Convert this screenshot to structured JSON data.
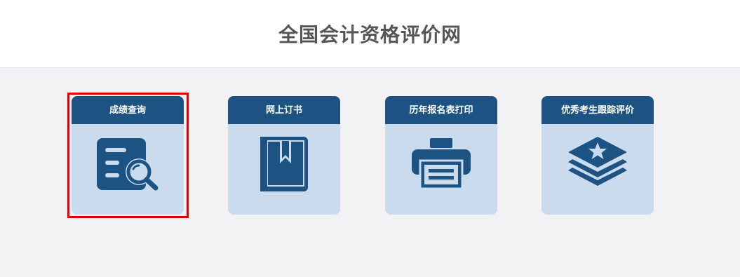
{
  "header": {
    "title": "全国会计资格评价网"
  },
  "cards": [
    {
      "label": "成绩查询",
      "icon": "document-search-icon"
    },
    {
      "label": "网上订书",
      "icon": "book-icon"
    },
    {
      "label": "历年报名表打印",
      "icon": "printer-icon"
    },
    {
      "label": "优秀考生跟踪评价",
      "icon": "layers-star-icon"
    }
  ],
  "selected_card": "成绩查询",
  "colors": {
    "card_header": "#1c5383",
    "card_body": "#c9dbed",
    "highlight": "#e0000a",
    "background": "#f2f2f4"
  }
}
